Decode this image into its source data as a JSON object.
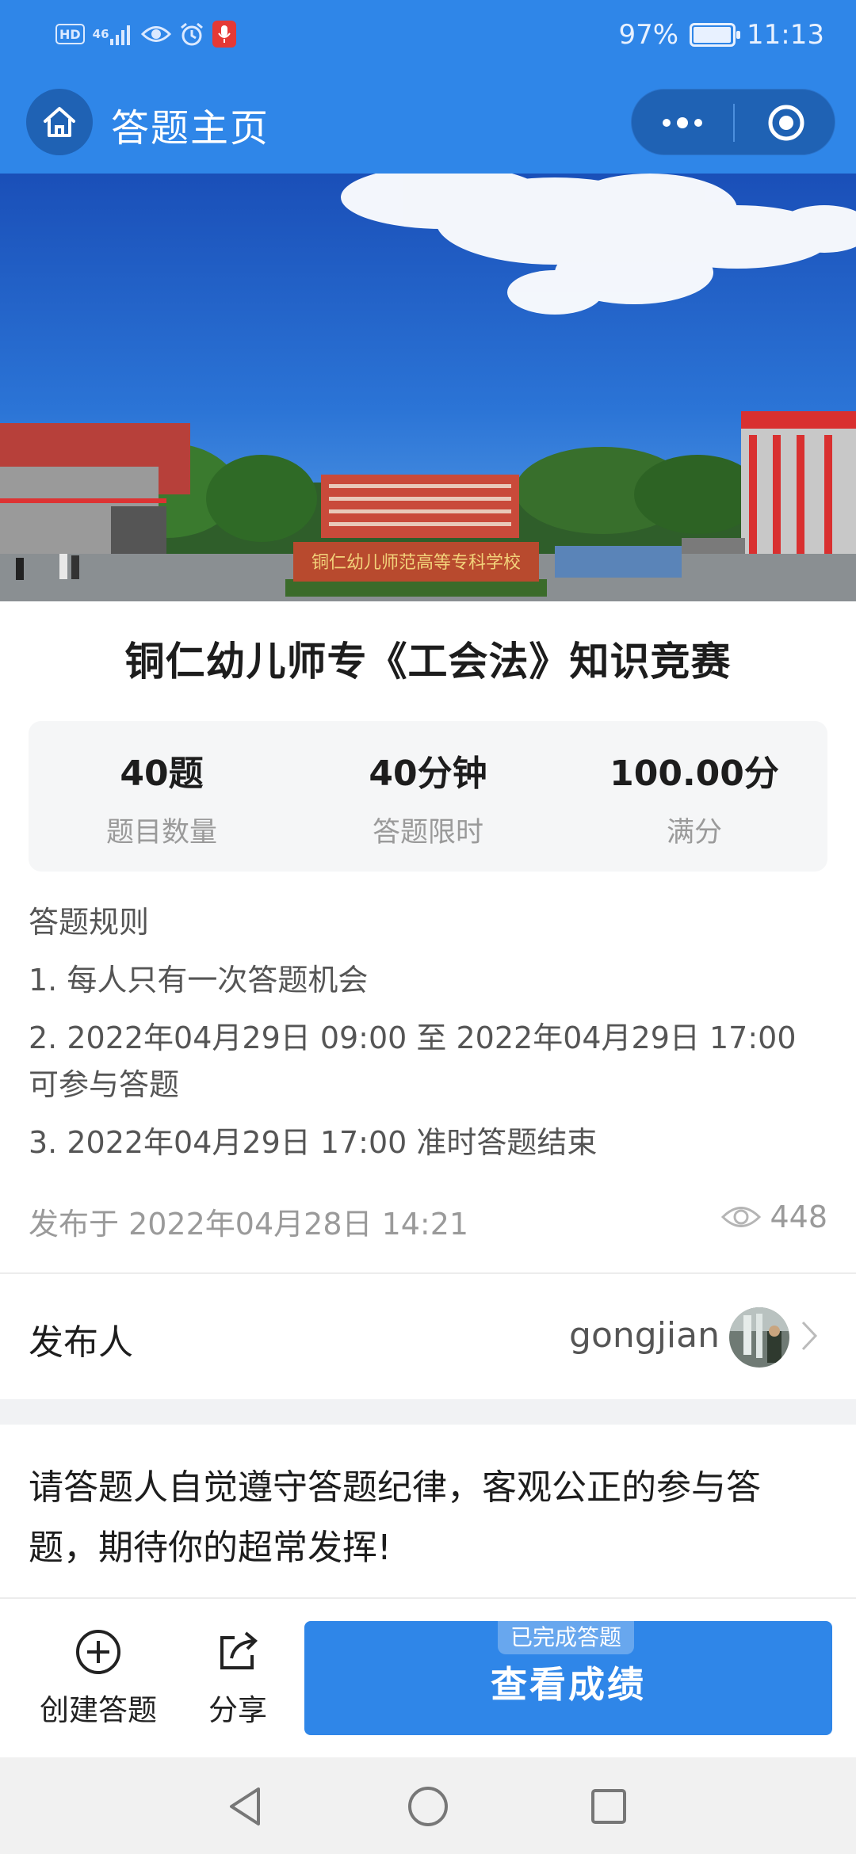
{
  "status_bar": {
    "left_icons": [
      "hd-icon",
      "4g-signal-icon",
      "eye-icon",
      "alarm-icon",
      "mic-icon"
    ],
    "hd_label": "HD",
    "network_label": "46",
    "battery": "97%",
    "battery_level": 0.97,
    "time": "11:13"
  },
  "header": {
    "title": "答题主页",
    "home_icon": "home-icon",
    "more_icon": "more-dots-icon",
    "close_icon": "target-circle-icon",
    "accent": "#2f86e8"
  },
  "banner": {
    "gate_sign": "铜仁幼儿师范高等专科学校"
  },
  "quiz": {
    "title": "铜仁幼儿师专《工会法》知识竞赛",
    "stats": [
      {
        "value": "40题",
        "label": "题目数量"
      },
      {
        "value": "40分钟",
        "label": "答题限时"
      },
      {
        "value": "100.00分",
        "label": "满分"
      }
    ],
    "rules_title": "答题规则",
    "rules": [
      "1. 每人只有一次答题机会",
      "2. 2022年04月29日 09:00 至 2022年04月29日 17:00 可参与答题",
      "3. 2022年04月29日 17:00 准时答题结束"
    ],
    "published": "发布于 2022年04月28日 14:21",
    "views": "448"
  },
  "publisher": {
    "label": "发布人",
    "name": "gongjian"
  },
  "notice": "请答题人自觉遵守答题纪律，客观公正的参与答题，期待你的超常发挥!",
  "bottom_bar": {
    "create_label": "创建答题",
    "share_label": "分享",
    "result_badge": "已完成答题",
    "result_label": "查看成绩"
  },
  "nav": {
    "back_icon": "back-triangle-icon",
    "home_icon": "home-circle-icon",
    "recents_icon": "recents-square-icon"
  }
}
